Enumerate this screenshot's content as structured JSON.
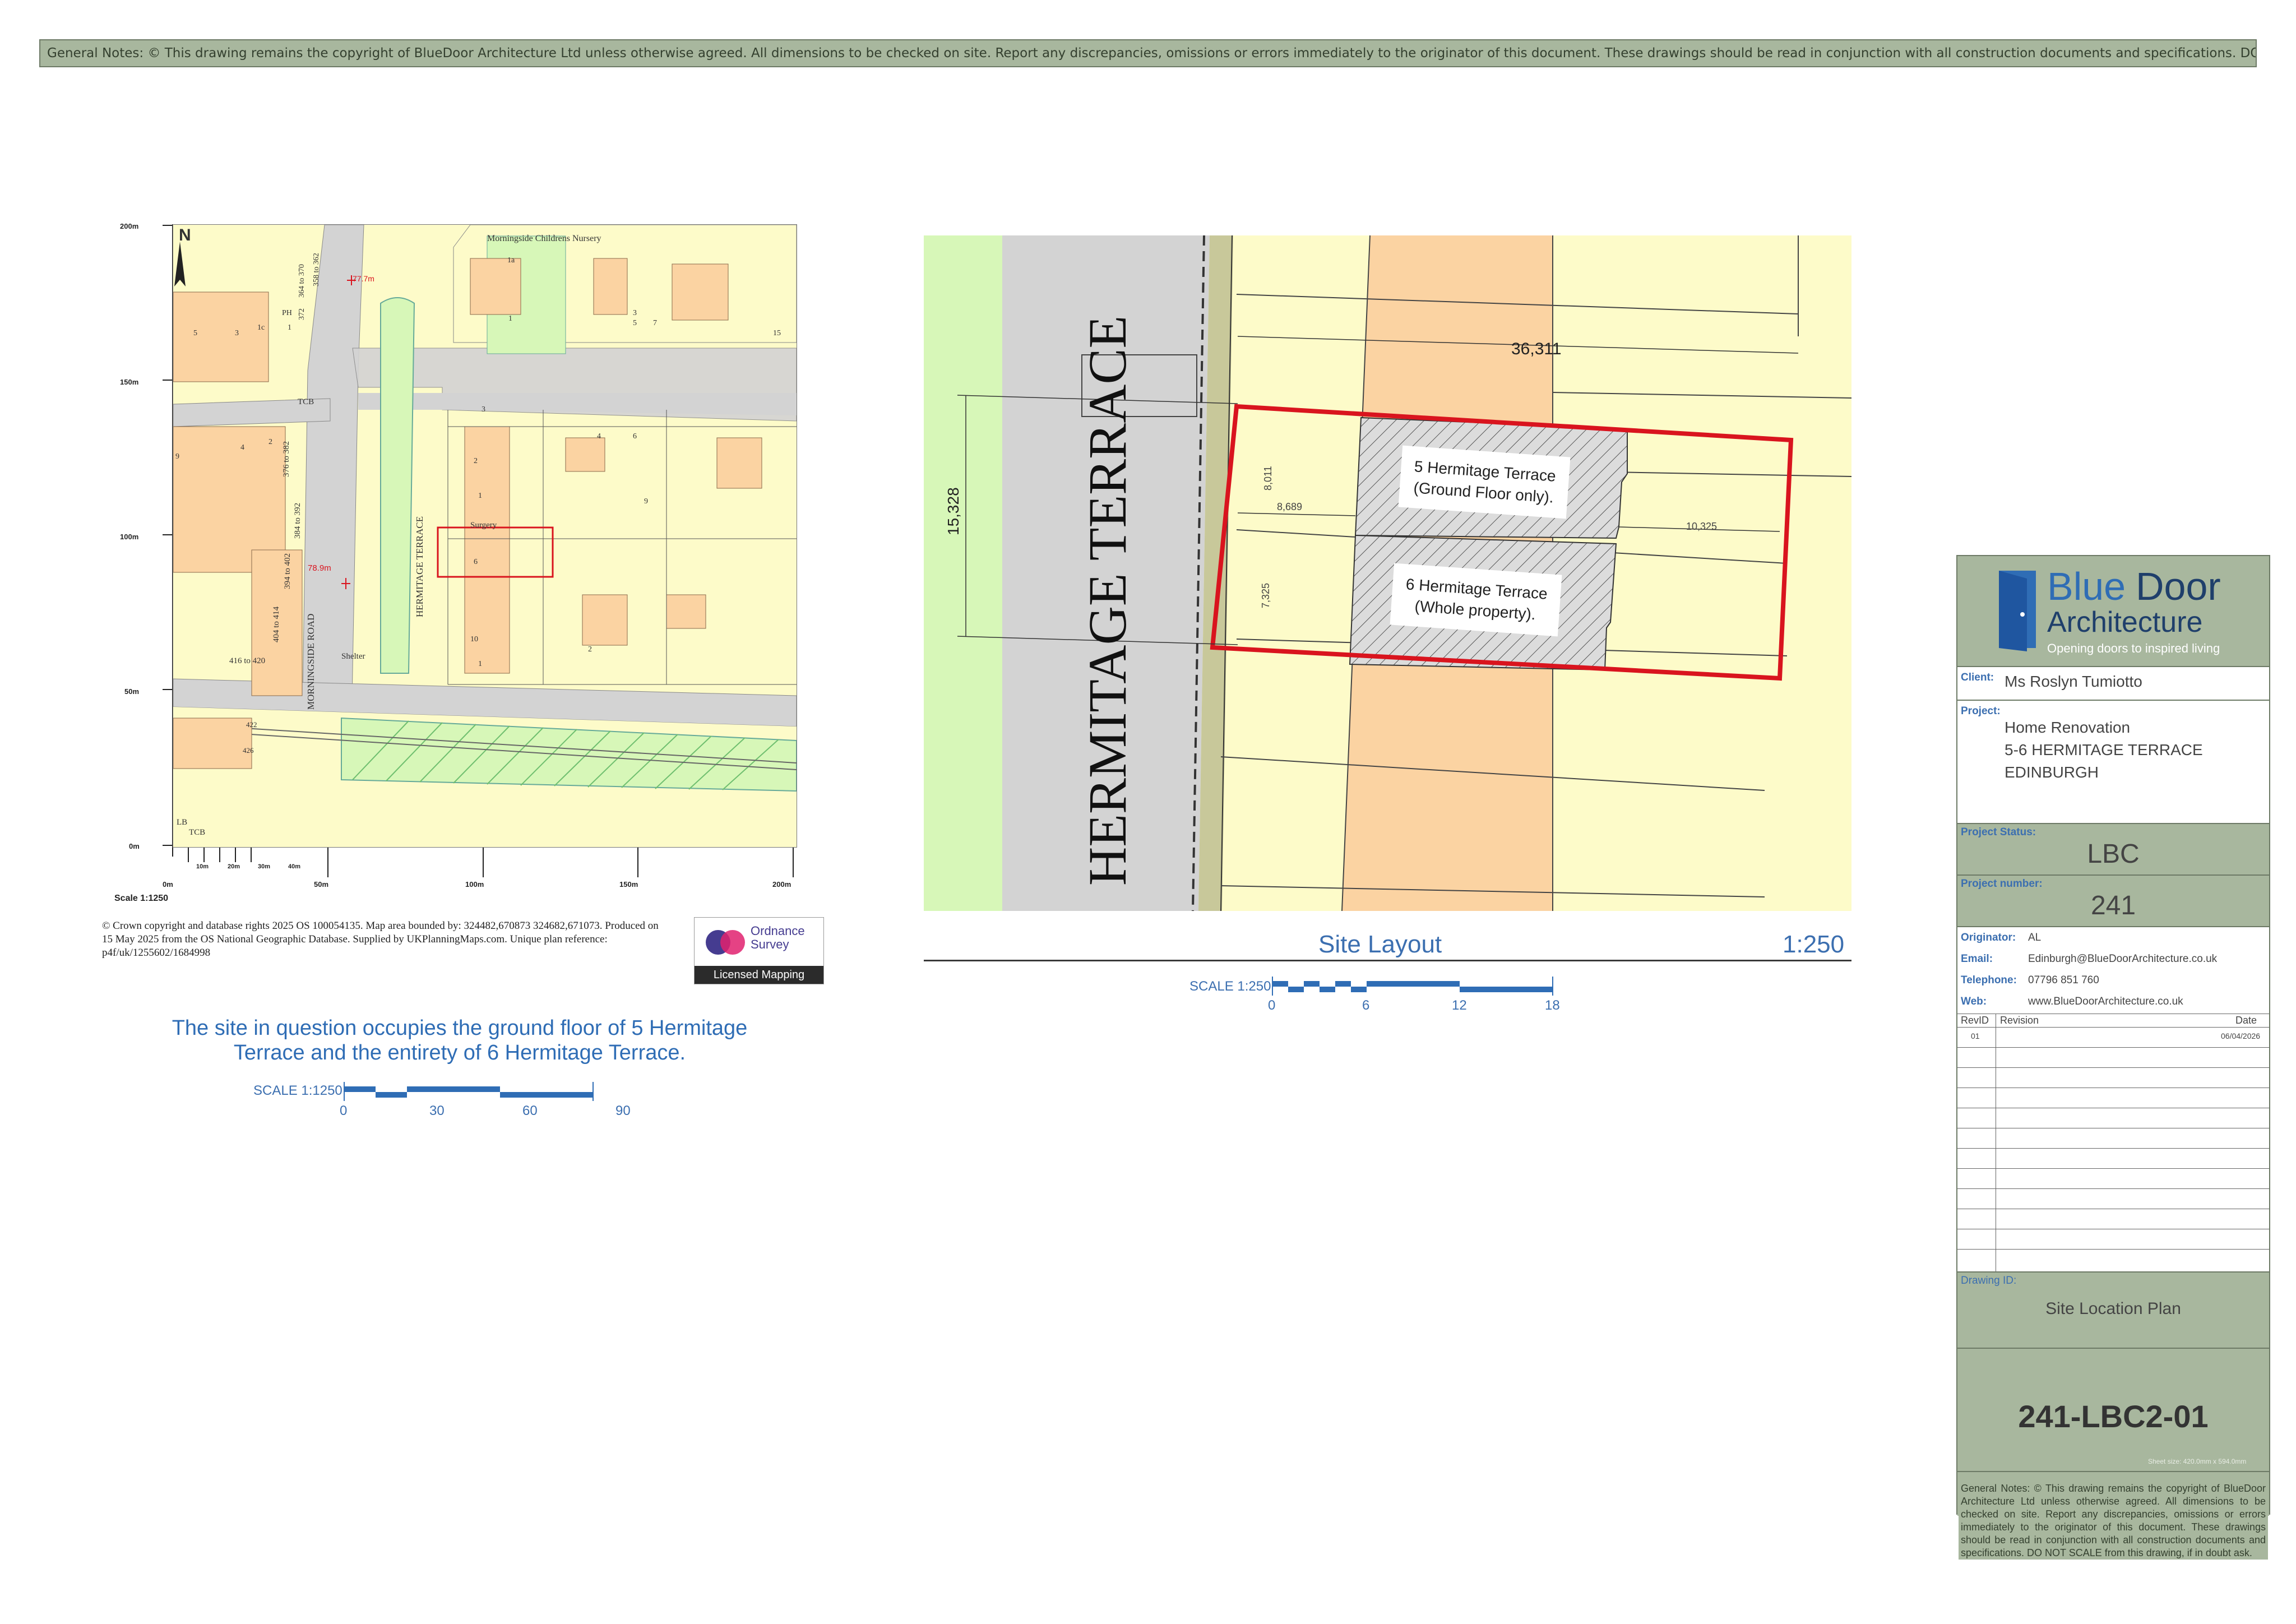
{
  "general_notes": "General Notes: © This drawing remains the copyright of BlueDoor Architecture Ltd unless otherwise agreed. All dimensions to be checked on site. Report any discrepancies, omissions or errors immediately to the originator of this document.  These drawings should be read in conjunction with all construction documents and specifications.   DO NOT SCALE from this drawing, if in doubt ask.",
  "os_map": {
    "north": "N",
    "y_labels": [
      "200m",
      "150m",
      "100m",
      "50m",
      "0m"
    ],
    "x_labels": [
      "0m",
      "50m",
      "100m",
      "150m",
      "200m"
    ],
    "small_labels": [
      "10m",
      "20m",
      "30m",
      "40m"
    ],
    "scale": "Scale 1:1250",
    "spot_heights": [
      "77.7m",
      "78.9m"
    ],
    "places": {
      "nursery": "Morningside Childrens Nursery",
      "morningside_road": "MORNINGSIDE ROAD",
      "hermitage_terrace": "HERMITAGE TERRACE",
      "surgery": "Surgery",
      "shelter": "Shelter",
      "tcb1": "TCB",
      "tcb2": "TCB",
      "lb": "LB",
      "range_416": "416 to 420",
      "range_404": "404 to 414",
      "range_394": "394 to 402",
      "range_384": "384 to 392",
      "range_376": "376 to 382",
      "range_364": "364 to 370",
      "range_358": "358 to 362",
      "num_372": "372",
      "ph": "PH",
      "num_1a": "1a",
      "num_1c": "1c"
    },
    "house_numbers": [
      "5",
      "3",
      "1",
      "9",
      "4",
      "2",
      "3",
      "5",
      "7",
      "15",
      "1",
      "3",
      "4",
      "6",
      "2",
      "1",
      "9",
      "10",
      "2",
      "1",
      "6",
      "422",
      "426"
    ]
  },
  "copyright": "© Crown copyright and database rights 2025 OS 100054135. Map area bounded by: 324482,670873 324682,671073. Produced on 15 May 2025 from the OS National Geographic Database. Supplied by UKPlanningMaps.com. Unique plan reference: p4f/uk/1255602/1684998",
  "os_badge": {
    "name_line1": "Ordnance",
    "name_line2": "Survey",
    "licensed": "Licensed Mapping"
  },
  "statement_line1": "The site in question occupies the ground floor of 5 Hermitage",
  "statement_line2": "Terrace and the entirety of 6 Hermitage Terrace.",
  "scale_bar_1250": {
    "label": "SCALE 1:1250",
    "ticks": [
      "0",
      "30",
      "60",
      "90"
    ]
  },
  "site_layout": {
    "street": "HERMITAGE TERRACE",
    "dim_width": "36,311",
    "dim_height": "15,328",
    "dim_8011": "8,011",
    "dim_8689": "8,689",
    "dim_7325": "7,325",
    "dim_10325": "10,325",
    "label5_line1": "5 Hermitage Terrace",
    "label5_line2": "(Ground Floor only).",
    "label6_line1": "6 Hermitage Terrace",
    "label6_line2": "(Whole property).",
    "title": "Site Layout",
    "scale": "1:250"
  },
  "scale_bar_250": {
    "label": "SCALE 1:250",
    "ticks": [
      "0",
      "6",
      "12",
      "18"
    ]
  },
  "title_block": {
    "logo_line1_a": "Blue",
    "logo_line1_b": "Door",
    "logo_line2": "Architecture",
    "tagline": "Opening doors to inspired living",
    "client_label": "Client:",
    "client": "Ms Roslyn Tumiotto",
    "project_label": "Project:",
    "project_line1": "Home Renovation",
    "project_line2": "5-6 HERMITAGE TERRACE",
    "project_line3": "EDINBURGH",
    "status_label": "Project Status:",
    "status": "LBC",
    "number_label": "Project number:",
    "number": "241",
    "originator_label": "Originator:",
    "originator": "AL",
    "email_label": "Email:",
    "email": "Edinburgh@BlueDoorArchitecture.co.uk",
    "telephone_label": "Telephone:",
    "telephone": "07796 851 760",
    "web_label": "Web:",
    "web": "www.BlueDoorArchitecture.co.uk",
    "rev_col1": "RevID",
    "rev_col2": "Revision",
    "rev_col3": "Date",
    "rev1_id": "01",
    "rev1_date": "06/04/2026",
    "drawing_id_label": "Drawing ID:",
    "drawing_title": "Site Location Plan",
    "drawing_number": "241-LBC2-01",
    "sheet_size": "Sheet size: 420.0mm x 594.0mm",
    "notes": "General Notes: © This drawing remains the copyright of BlueDoor Architecture Ltd unless otherwise agreed. All dimensions to be checked on site. Report any discrepancies, omissions or errors immediately to the originator of this document.  These drawings should be read in conjunction with all construction documents and specifications.  DO NOT SCALE from this drawing, if in doubt ask."
  },
  "colors": {
    "accent_blue": "#3c6fb0",
    "sage_green": "#a8b79e",
    "site_red": "#d9141e",
    "plot_yellow": "#fdfbc9",
    "plot_orange": "#fbd3a2",
    "road_grey": "#d3d3d3",
    "green_space": "#d7f7b8"
  }
}
